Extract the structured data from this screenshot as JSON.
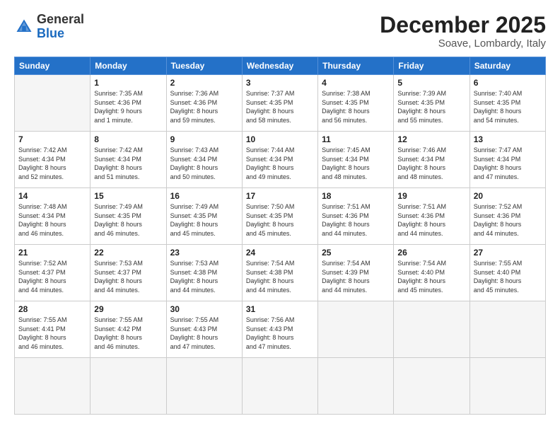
{
  "logo": {
    "general": "General",
    "blue": "Blue"
  },
  "title": "December 2025",
  "subtitle": "Soave, Lombardy, Italy",
  "days": [
    "Sunday",
    "Monday",
    "Tuesday",
    "Wednesday",
    "Thursday",
    "Friday",
    "Saturday"
  ],
  "cells": [
    {
      "day": "",
      "content": ""
    },
    {
      "day": "1",
      "content": "Sunrise: 7:35 AM\nSunset: 4:36 PM\nDaylight: 9 hours\nand 1 minute."
    },
    {
      "day": "2",
      "content": "Sunrise: 7:36 AM\nSunset: 4:36 PM\nDaylight: 8 hours\nand 59 minutes."
    },
    {
      "day": "3",
      "content": "Sunrise: 7:37 AM\nSunset: 4:35 PM\nDaylight: 8 hours\nand 58 minutes."
    },
    {
      "day": "4",
      "content": "Sunrise: 7:38 AM\nSunset: 4:35 PM\nDaylight: 8 hours\nand 56 minutes."
    },
    {
      "day": "5",
      "content": "Sunrise: 7:39 AM\nSunset: 4:35 PM\nDaylight: 8 hours\nand 55 minutes."
    },
    {
      "day": "6",
      "content": "Sunrise: 7:40 AM\nSunset: 4:35 PM\nDaylight: 8 hours\nand 54 minutes."
    },
    {
      "day": "7",
      "content": "Sunrise: 7:42 AM\nSunset: 4:34 PM\nDaylight: 8 hours\nand 52 minutes."
    },
    {
      "day": "8",
      "content": "Sunrise: 7:42 AM\nSunset: 4:34 PM\nDaylight: 8 hours\nand 51 minutes."
    },
    {
      "day": "9",
      "content": "Sunrise: 7:43 AM\nSunset: 4:34 PM\nDaylight: 8 hours\nand 50 minutes."
    },
    {
      "day": "10",
      "content": "Sunrise: 7:44 AM\nSunset: 4:34 PM\nDaylight: 8 hours\nand 49 minutes."
    },
    {
      "day": "11",
      "content": "Sunrise: 7:45 AM\nSunset: 4:34 PM\nDaylight: 8 hours\nand 48 minutes."
    },
    {
      "day": "12",
      "content": "Sunrise: 7:46 AM\nSunset: 4:34 PM\nDaylight: 8 hours\nand 48 minutes."
    },
    {
      "day": "13",
      "content": "Sunrise: 7:47 AM\nSunset: 4:34 PM\nDaylight: 8 hours\nand 47 minutes."
    },
    {
      "day": "14",
      "content": "Sunrise: 7:48 AM\nSunset: 4:34 PM\nDaylight: 8 hours\nand 46 minutes."
    },
    {
      "day": "15",
      "content": "Sunrise: 7:49 AM\nSunset: 4:35 PM\nDaylight: 8 hours\nand 46 minutes."
    },
    {
      "day": "16",
      "content": "Sunrise: 7:49 AM\nSunset: 4:35 PM\nDaylight: 8 hours\nand 45 minutes."
    },
    {
      "day": "17",
      "content": "Sunrise: 7:50 AM\nSunset: 4:35 PM\nDaylight: 8 hours\nand 45 minutes."
    },
    {
      "day": "18",
      "content": "Sunrise: 7:51 AM\nSunset: 4:36 PM\nDaylight: 8 hours\nand 44 minutes."
    },
    {
      "day": "19",
      "content": "Sunrise: 7:51 AM\nSunset: 4:36 PM\nDaylight: 8 hours\nand 44 minutes."
    },
    {
      "day": "20",
      "content": "Sunrise: 7:52 AM\nSunset: 4:36 PM\nDaylight: 8 hours\nand 44 minutes."
    },
    {
      "day": "21",
      "content": "Sunrise: 7:52 AM\nSunset: 4:37 PM\nDaylight: 8 hours\nand 44 minutes."
    },
    {
      "day": "22",
      "content": "Sunrise: 7:53 AM\nSunset: 4:37 PM\nDaylight: 8 hours\nand 44 minutes."
    },
    {
      "day": "23",
      "content": "Sunrise: 7:53 AM\nSunset: 4:38 PM\nDaylight: 8 hours\nand 44 minutes."
    },
    {
      "day": "24",
      "content": "Sunrise: 7:54 AM\nSunset: 4:38 PM\nDaylight: 8 hours\nand 44 minutes."
    },
    {
      "day": "25",
      "content": "Sunrise: 7:54 AM\nSunset: 4:39 PM\nDaylight: 8 hours\nand 44 minutes."
    },
    {
      "day": "26",
      "content": "Sunrise: 7:54 AM\nSunset: 4:40 PM\nDaylight: 8 hours\nand 45 minutes."
    },
    {
      "day": "27",
      "content": "Sunrise: 7:55 AM\nSunset: 4:40 PM\nDaylight: 8 hours\nand 45 minutes."
    },
    {
      "day": "28",
      "content": "Sunrise: 7:55 AM\nSunset: 4:41 PM\nDaylight: 8 hours\nand 46 minutes."
    },
    {
      "day": "29",
      "content": "Sunrise: 7:55 AM\nSunset: 4:42 PM\nDaylight: 8 hours\nand 46 minutes."
    },
    {
      "day": "30",
      "content": "Sunrise: 7:55 AM\nSunset: 4:43 PM\nDaylight: 8 hours\nand 47 minutes."
    },
    {
      "day": "31",
      "content": "Sunrise: 7:56 AM\nSunset: 4:43 PM\nDaylight: 8 hours\nand 47 minutes."
    },
    {
      "day": "",
      "content": ""
    },
    {
      "day": "",
      "content": ""
    },
    {
      "day": "",
      "content": ""
    },
    {
      "day": "",
      "content": ""
    }
  ]
}
